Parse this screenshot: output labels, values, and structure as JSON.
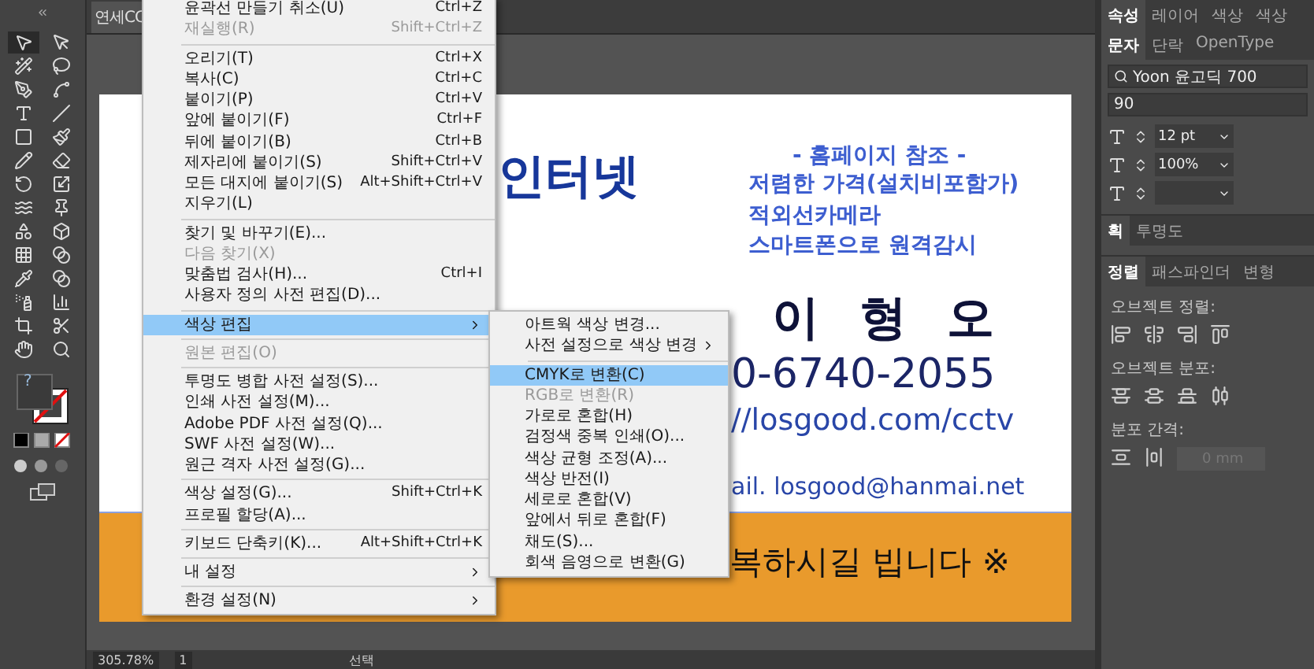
{
  "document_tab": {
    "title": "연세CC"
  },
  "tools": [
    {
      "kind": "select",
      "selected": true
    },
    {
      "kind": "direct",
      "selected": false
    },
    {
      "kind": "wand",
      "selected": false
    },
    {
      "kind": "lasso",
      "selected": false
    },
    {
      "kind": "pen",
      "selected": false
    },
    {
      "kind": "curve",
      "selected": false
    },
    {
      "kind": "type",
      "selected": false
    },
    {
      "kind": "line",
      "selected": false
    },
    {
      "kind": "rect",
      "selected": false
    },
    {
      "kind": "brush",
      "selected": false
    },
    {
      "kind": "pencil",
      "selected": false
    },
    {
      "kind": "eraser",
      "selected": false
    },
    {
      "kind": "rotate",
      "selected": false
    },
    {
      "kind": "scale",
      "selected": false
    },
    {
      "kind": "warp",
      "selected": false
    },
    {
      "kind": "pin",
      "selected": false
    },
    {
      "kind": "shapes",
      "selected": false
    },
    {
      "kind": "box",
      "selected": false
    },
    {
      "kind": "mesh",
      "selected": false
    },
    {
      "kind": "gradient",
      "selected": false
    },
    {
      "kind": "eyedropper",
      "selected": false
    },
    {
      "kind": "blend",
      "selected": false
    },
    {
      "kind": "spray",
      "selected": false
    },
    {
      "kind": "chart",
      "selected": false
    },
    {
      "kind": "crop",
      "selected": false
    },
    {
      "kind": "knife",
      "selected": false
    },
    {
      "kind": "hand",
      "selected": false
    },
    {
      "kind": "zoom",
      "selected": false
    }
  ],
  "fill_stroke": {
    "fill_label": "?"
  },
  "canvas": {
    "texts": [
      {
        "kind": "title",
        "text": "인터넷"
      },
      {
        "kind": "heading",
        "text": "- 홈페이지 참조 -"
      },
      {
        "kind": "line1",
        "text": "저렴한 가격(설치비포함가)"
      },
      {
        "kind": "line2",
        "text": "적외선카메라"
      },
      {
        "kind": "line3",
        "text": "스마트폰으로 원격감시"
      },
      {
        "kind": "name",
        "text": "이 형 오"
      },
      {
        "kind": "phone",
        "text": "0-6740-2055"
      },
      {
        "kind": "url",
        "text": "//losgood.com/cctv"
      },
      {
        "kind": "email",
        "text": "ail. losgood@hanmai.net"
      }
    ],
    "banner": {
      "text": "복하시길 빕니다 ※"
    }
  },
  "menu": {
    "items": [
      {
        "kind": "item",
        "label": "윤곽선 만들기 취소(U)",
        "shortcut": "Ctrl+Z",
        "disabled": false,
        "highlighted": false
      },
      {
        "kind": "item",
        "label": "재실행(R)",
        "shortcut": "Shift+Ctrl+Z",
        "disabled": true,
        "highlighted": false
      },
      {
        "kind": "separator"
      },
      {
        "kind": "item",
        "label": "오리기(T)",
        "shortcut": "Ctrl+X",
        "disabled": false,
        "highlighted": false
      },
      {
        "kind": "item",
        "label": "복사(C)",
        "shortcut": "Ctrl+C",
        "disabled": false,
        "highlighted": false
      },
      {
        "kind": "item",
        "label": "붙이기(P)",
        "shortcut": "Ctrl+V",
        "disabled": false,
        "highlighted": false
      },
      {
        "kind": "item",
        "label": "앞에 붙이기(F)",
        "shortcut": "Ctrl+F",
        "disabled": false,
        "highlighted": false
      },
      {
        "kind": "item",
        "label": "뒤에 붙이기(B)",
        "shortcut": "Ctrl+B",
        "disabled": false,
        "highlighted": false
      },
      {
        "kind": "item",
        "label": "제자리에 붙이기(S)",
        "shortcut": "Shift+Ctrl+V",
        "disabled": false,
        "highlighted": false
      },
      {
        "kind": "item",
        "label": "모든 대지에 붙이기(S)",
        "shortcut": "Alt+Shift+Ctrl+V",
        "disabled": false,
        "highlighted": false
      },
      {
        "kind": "item",
        "label": "지우기(L)",
        "disabled": false,
        "highlighted": false
      },
      {
        "kind": "separator"
      },
      {
        "kind": "item",
        "label": "찾기 및 바꾸기(E)...",
        "disabled": false,
        "highlighted": false
      },
      {
        "kind": "item",
        "label": "다음 찾기(X)",
        "disabled": true,
        "highlighted": false
      },
      {
        "kind": "item",
        "label": "맞춤법 검사(H)...",
        "shortcut": "Ctrl+I",
        "disabled": false,
        "highlighted": false
      },
      {
        "kind": "item",
        "label": "사용자 정의 사전 편집(D)...",
        "disabled": false,
        "highlighted": false
      },
      {
        "kind": "separator"
      },
      {
        "kind": "submenu",
        "label": "색상 편집",
        "disabled": false,
        "highlighted": true
      },
      {
        "kind": "separator"
      },
      {
        "kind": "item",
        "label": "원본 편집(O)",
        "disabled": true,
        "highlighted": false
      },
      {
        "kind": "separator"
      },
      {
        "kind": "item",
        "label": "투명도 병합 사전 설정(S)...",
        "disabled": false,
        "highlighted": false
      },
      {
        "kind": "item",
        "label": "인쇄 사전 설정(M)...",
        "disabled": false,
        "highlighted": false
      },
      {
        "kind": "item",
        "label": "Adobe PDF 사전 설정(Q)...",
        "disabled": false,
        "highlighted": false
      },
      {
        "kind": "item",
        "label": "SWF 사전 설정(W)...",
        "disabled": false,
        "highlighted": false
      },
      {
        "kind": "item",
        "label": "원근 격자 사전 설정(G)...",
        "disabled": false,
        "highlighted": false
      },
      {
        "kind": "separator"
      },
      {
        "kind": "item",
        "label": "색상 설정(G)...",
        "shortcut": "Shift+Ctrl+K",
        "disabled": false,
        "highlighted": false
      },
      {
        "kind": "item",
        "label": "프로필 할당(A)...",
        "disabled": false,
        "highlighted": false
      },
      {
        "kind": "separator"
      },
      {
        "kind": "item",
        "label": "키보드 단축키(K)...",
        "shortcut": "Alt+Shift+Ctrl+K",
        "disabled": false,
        "highlighted": false
      },
      {
        "kind": "separator"
      },
      {
        "kind": "submenu",
        "label": "내 설정",
        "disabled": false,
        "highlighted": false
      },
      {
        "kind": "separator"
      },
      {
        "kind": "submenu",
        "label": "환경 설정(N)",
        "disabled": false,
        "highlighted": false
      }
    ]
  },
  "submenu": {
    "items": [
      {
        "kind": "item",
        "label": "아트웍 색상 변경...",
        "disabled": false,
        "highlighted": false
      },
      {
        "kind": "submenu",
        "label": "사전 설정으로 색상 변경",
        "disabled": false,
        "highlighted": false
      },
      {
        "kind": "separator"
      },
      {
        "kind": "item",
        "label": "CMYK로 변환(C)",
        "disabled": false,
        "highlighted": true
      },
      {
        "kind": "item",
        "label": "RGB로 변환(R)",
        "disabled": true,
        "highlighted": false
      },
      {
        "kind": "item",
        "label": "가로로 혼합(H)",
        "disabled": false,
        "highlighted": false
      },
      {
        "kind": "item",
        "label": "검정색 중복 인쇄(O)...",
        "disabled": false,
        "highlighted": false
      },
      {
        "kind": "item",
        "label": "색상 균형 조정(A)...",
        "disabled": false,
        "highlighted": false
      },
      {
        "kind": "item",
        "label": "색상 반전(I)",
        "disabled": false,
        "highlighted": false
      },
      {
        "kind": "item",
        "label": "세로로 혼합(V)",
        "disabled": false,
        "highlighted": false
      },
      {
        "kind": "item",
        "label": "앞에서 뒤로 혼합(F)",
        "disabled": false,
        "highlighted": false
      },
      {
        "kind": "item",
        "label": "채도(S)...",
        "disabled": false,
        "highlighted": false
      },
      {
        "kind": "item",
        "label": "회색 음영으로 변환(G)",
        "disabled": false,
        "highlighted": false
      }
    ]
  },
  "panel": {
    "tabs": [
      {
        "label": "속성",
        "selected": true
      },
      {
        "label": "레이어",
        "selected": false
      },
      {
        "label": "색상",
        "selected": false
      },
      {
        "label": "색상",
        "selected": false
      }
    ],
    "character_tabs": [
      {
        "label": "문자",
        "selected": true
      },
      {
        "label": "단락",
        "selected": false
      },
      {
        "label": "OpenType",
        "selected": false
      }
    ],
    "font_family": "Yoon 윤고딕 700",
    "font_style": "90",
    "font_size": "12 pt",
    "leading": "100%",
    "stroke_tabs": [
      {
        "label": "획",
        "selected": true
      },
      {
        "label": "투명도",
        "selected": false
      }
    ],
    "align_tabs": [
      {
        "label": "정렬",
        "selected": true
      },
      {
        "label": "패스파인더",
        "selected": false
      },
      {
        "label": "변형",
        "selected": false
      }
    ],
    "align_label": "오브젝트 정렬:",
    "distribute_label": "오브젝트 분포:",
    "spacing_label": "분포 간격:",
    "spacing_value": "0 mm"
  },
  "status_bar": {
    "zoom": "305.78%",
    "artboard": "1",
    "tool": "선택"
  }
}
